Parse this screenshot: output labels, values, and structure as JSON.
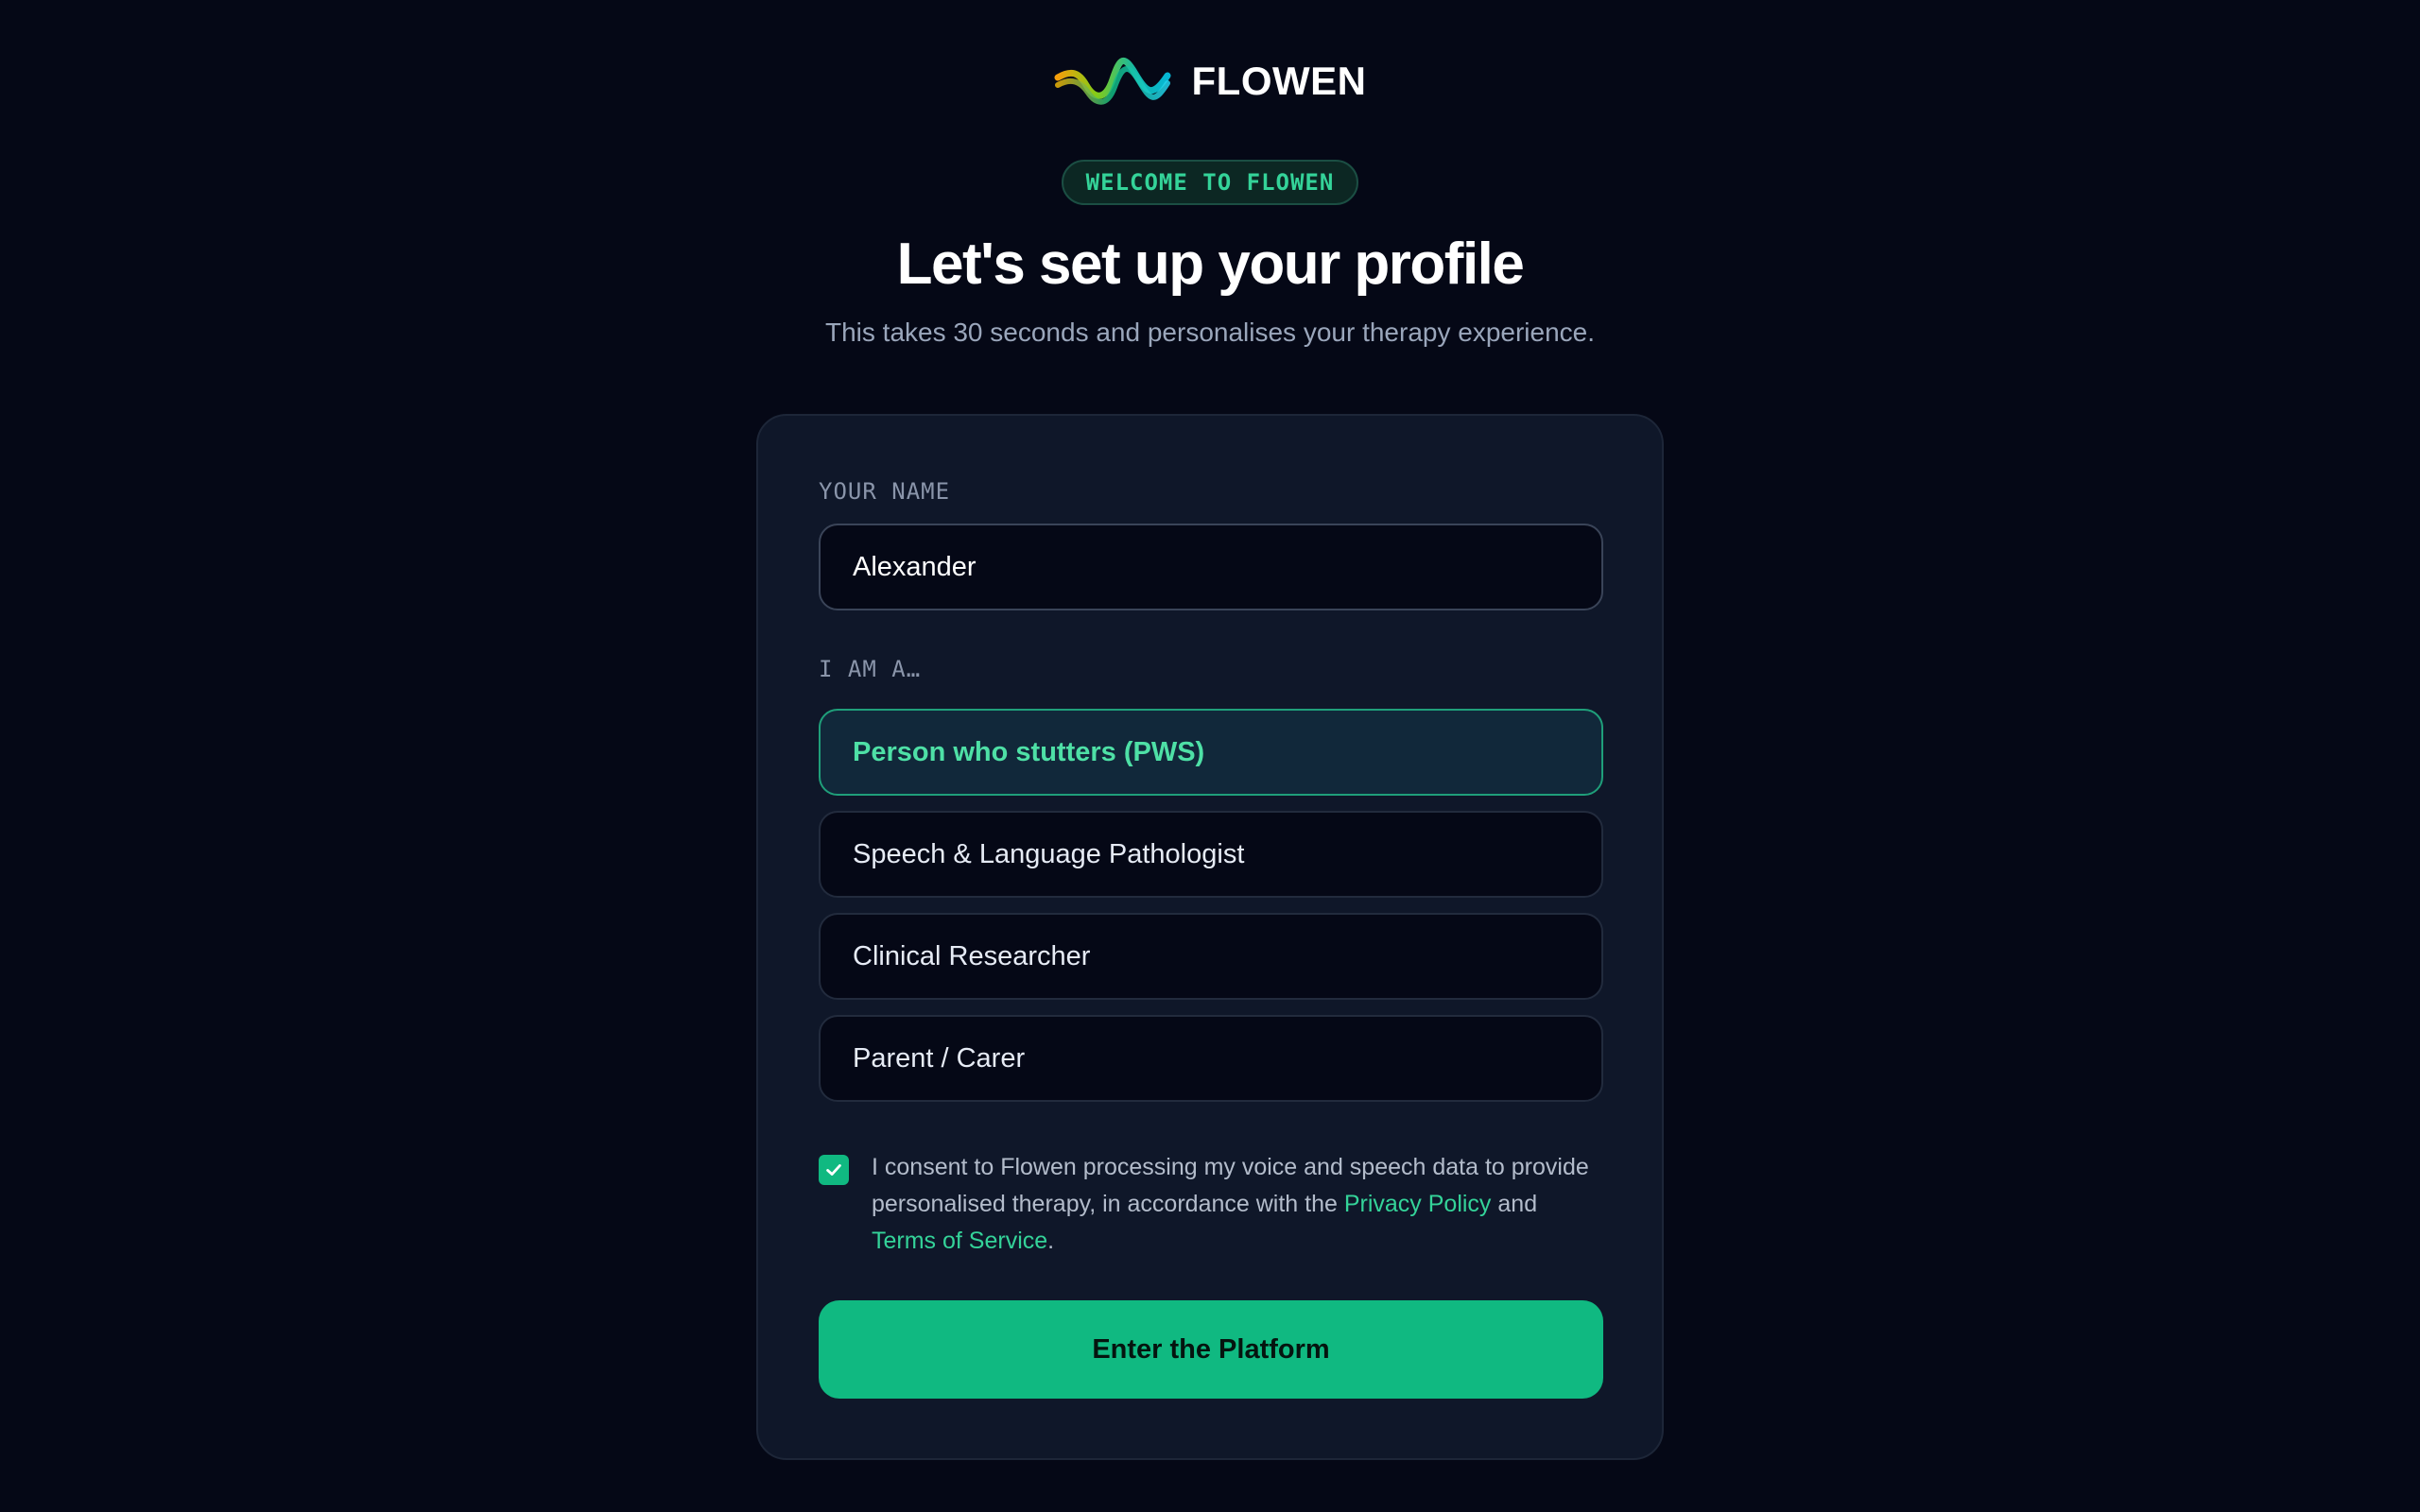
{
  "brand": {
    "name": "FLOWEN",
    "logo_icon": "wave-logo-icon"
  },
  "header": {
    "badge": "WELCOME TO FLOWEN",
    "title": "Let's set up your profile",
    "subtitle": "This takes 30 seconds and personalises your therapy experience."
  },
  "form": {
    "name_label": "YOUR NAME",
    "name_value": "Alexander",
    "role_label": "I AM A…",
    "roles": [
      {
        "label": "Person who stutters (PWS)",
        "selected": true
      },
      {
        "label": "Speech & Language Pathologist",
        "selected": false
      },
      {
        "label": "Clinical Researcher",
        "selected": false
      },
      {
        "label": "Parent / Carer",
        "selected": false
      }
    ],
    "consent": {
      "checked": true,
      "text_before": "I consent to Flowen processing my voice and speech data to provide personalised therapy, in accordance with the ",
      "privacy_link": "Privacy Policy",
      "text_and": " and ",
      "terms_link": "Terms of Service",
      "text_end": "."
    },
    "submit_label": "Enter the Platform"
  },
  "colors": {
    "background": "#050816",
    "card": "#0f1729",
    "accent": "#10b981",
    "accent_text": "#34d399"
  }
}
